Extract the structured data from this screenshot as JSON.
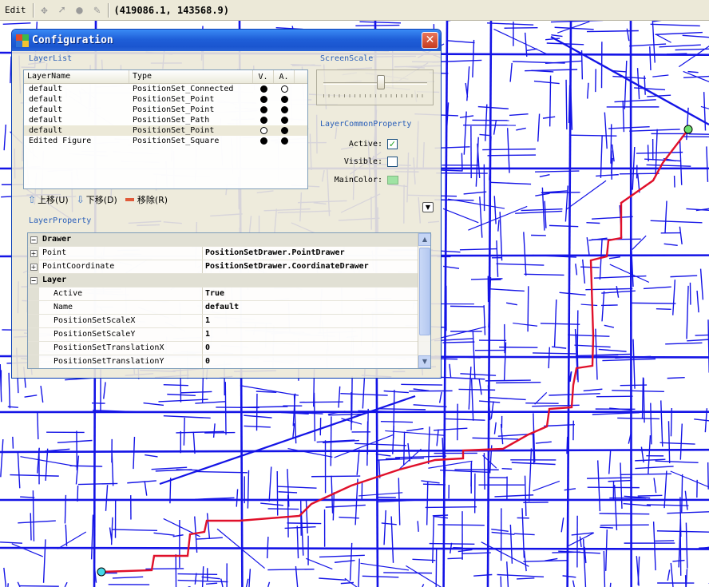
{
  "toolbar": {
    "edit_label": "Edit",
    "coordinate": "(419086.1, 143568.9)"
  },
  "colors": {
    "road": "#1414e6",
    "route": "#e0102a",
    "titlebar": "#1f5fd8",
    "accent_label": "#2a5fb8",
    "main_color": "#9fe3a3"
  },
  "dialog": {
    "title": "Configuration",
    "close_glyph": "✕",
    "layer_list": {
      "label": "LayerList",
      "columns": [
        "LayerName",
        "Type",
        "V.",
        "A."
      ],
      "rows": [
        {
          "name": "default",
          "type": "PositionSet_Connected",
          "visible": true,
          "active": false
        },
        {
          "name": "default",
          "type": "PositionSet_Point",
          "visible": true,
          "active": true
        },
        {
          "name": "default",
          "type": "PositionSet_Point",
          "visible": true,
          "active": true
        },
        {
          "name": "default",
          "type": "PositionSet_Path",
          "visible": true,
          "active": true
        },
        {
          "name": "default",
          "type": "PositionSet_Point",
          "visible": false,
          "active": true
        },
        {
          "name": "Edited Figure",
          "type": "PositionSet_Square",
          "visible": true,
          "active": true
        }
      ],
      "selected_row": 4,
      "buttons": {
        "move_up": "上移(U)",
        "move_down": "下移(D)",
        "remove": "移除(R)"
      }
    },
    "screen_scale": {
      "label": "ScreenScale",
      "value": 0.55
    },
    "layer_common_property": {
      "label": "LayerCommonProperty",
      "active_label": "Active:",
      "active": true,
      "visible_label": "Visible:",
      "visible": false,
      "main_color_label": "MainColor:"
    },
    "layer_property": {
      "label": "LayerProperty",
      "categories": [
        {
          "name": "Drawer",
          "expanded": true,
          "props": [
            {
              "name": "Point",
              "value": "PositionSetDrawer.PointDrawer",
              "expandable": true
            },
            {
              "name": "PointCoordinate",
              "value": "PositionSetDrawer.CoordinateDrawer",
              "expandable": true
            }
          ]
        },
        {
          "name": "Layer",
          "expanded": true,
          "props": [
            {
              "name": "Active",
              "value": "True",
              "expandable": false
            },
            {
              "name": "Name",
              "value": "default",
              "expandable": false
            },
            {
              "name": "PositionSetScaleX",
              "value": "1",
              "expandable": false
            },
            {
              "name": "PositionSetScaleY",
              "value": "1",
              "expandable": false
            },
            {
              "name": "PositionSetTranslationX",
              "value": "0",
              "expandable": false
            },
            {
              "name": "PositionSetTranslationY",
              "value": "0",
              "expandable": false
            }
          ]
        }
      ]
    }
  }
}
